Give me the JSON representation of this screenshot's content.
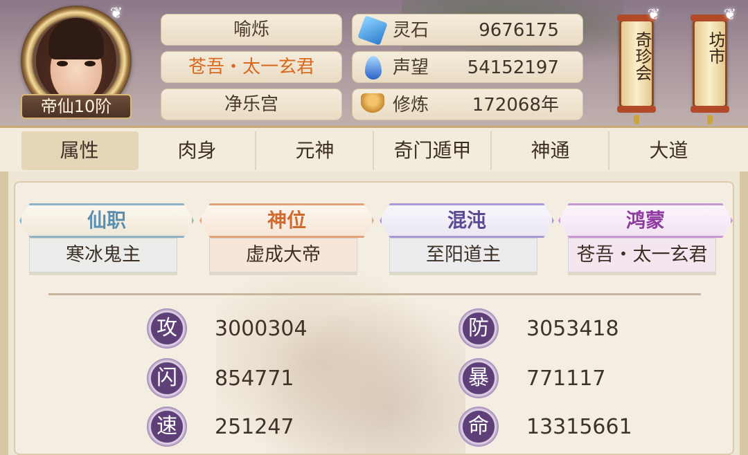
{
  "player": {
    "rank": "帝仙10阶",
    "name": "喻烁",
    "title": "苍吾・太一玄君",
    "sect": "净乐宫"
  },
  "resources": [
    {
      "icon": "spirit-stone-icon",
      "label": "灵石",
      "value": "9676175"
    },
    {
      "icon": "reputation-icon",
      "label": "声望",
      "value": "54152197"
    },
    {
      "icon": "cultivation-icon",
      "label": "修炼",
      "value": "172068年"
    }
  ],
  "shortcuts": {
    "treasure_hall": "奇珍会",
    "market": "坊市"
  },
  "tabs": [
    "属性",
    "肉身",
    "元神",
    "奇门遁甲",
    "神通",
    "大道"
  ],
  "active_tab": "属性",
  "titles": [
    {
      "category": "仙职",
      "value": "寒冰鬼主",
      "color": "#5a8fb0"
    },
    {
      "category": "神位",
      "value": "虚成大帝",
      "color": "#d06a2e"
    },
    {
      "category": "混沌",
      "value": "至阳道主",
      "color": "#5b4a92"
    },
    {
      "category": "鸿蒙",
      "value": "苍吾・太一玄君",
      "color": "#8e3aa0"
    }
  ],
  "stats": [
    {
      "label": "攻",
      "value": "3000304"
    },
    {
      "label": "防",
      "value": "3053418"
    },
    {
      "label": "闪",
      "value": "854771"
    },
    {
      "label": "暴",
      "value": "771117"
    },
    {
      "label": "速",
      "value": "251247"
    },
    {
      "label": "命",
      "value": "13315661"
    }
  ]
}
